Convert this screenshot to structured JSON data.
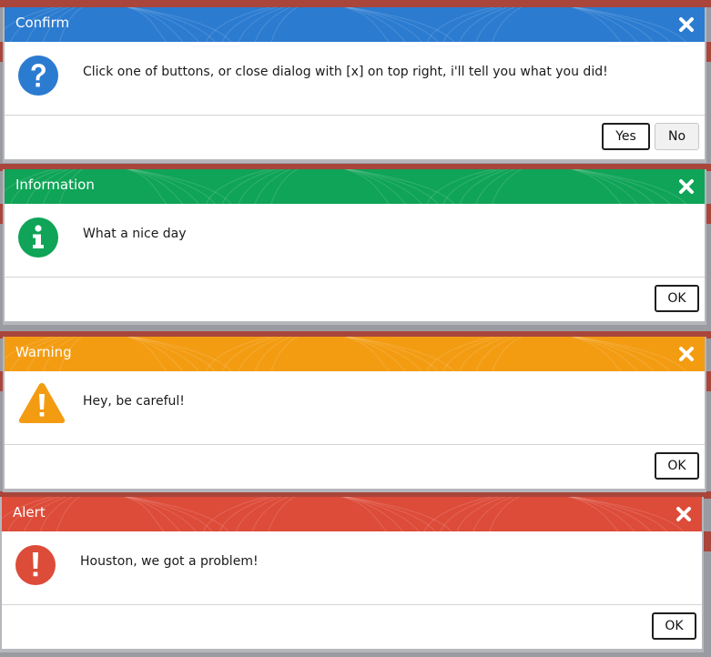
{
  "dialogs": [
    {
      "title": "Confirm",
      "message": "Click one of buttons, or close dialog with [x] on top right, i'll tell you what you did!",
      "color": "#2b7bd0",
      "icon": "question-icon",
      "buttons": [
        "Yes",
        "No"
      ]
    },
    {
      "title": "Information",
      "message": "What a nice day",
      "color": "#0fa457",
      "icon": "info-icon",
      "buttons": [
        "OK"
      ]
    },
    {
      "title": "Warning",
      "message": "Hey, be careful!",
      "color": "#f39c12",
      "icon": "warning-icon",
      "buttons": [
        "OK"
      ]
    },
    {
      "title": "Alert",
      "message": "Houston, we got a problem!",
      "color": "#dd4b39",
      "icon": "exclamation-icon",
      "buttons": [
        "OK"
      ]
    }
  ],
  "colors": {
    "backdrop": "#9a9ba1",
    "backdrop_bar": "#a9453b"
  }
}
